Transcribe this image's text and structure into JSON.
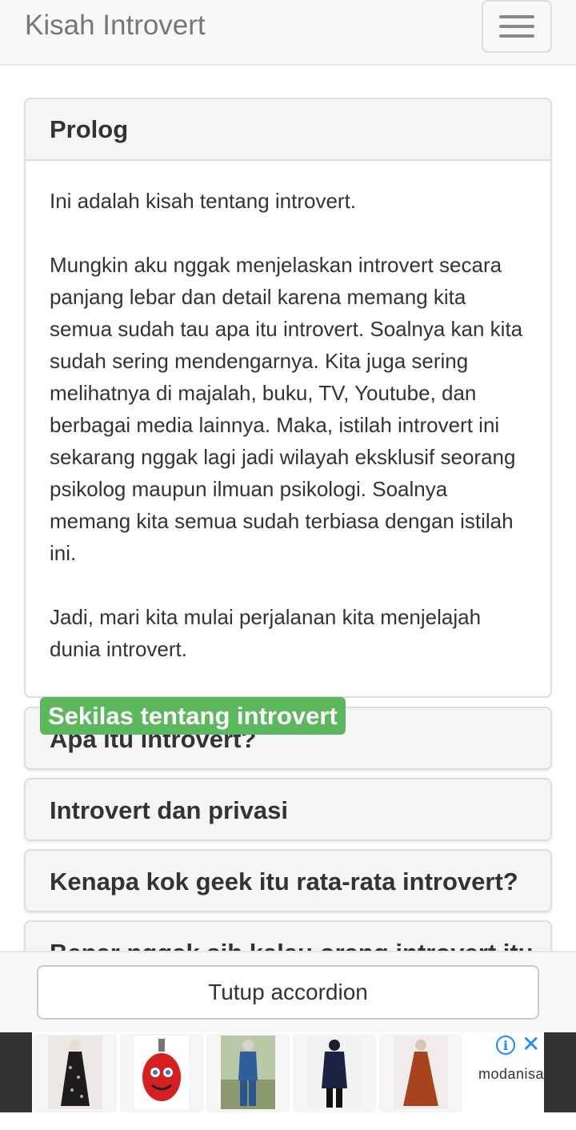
{
  "navbar": {
    "brand": "Kisah Introvert"
  },
  "accordion": {
    "open_panel": {
      "title": "Prolog",
      "paragraphs": [
        "Ini adalah kisah tentang introvert.",
        "Mungkin aku nggak menjelaskan introvert secara panjang lebar dan detail karena memang kita semua sudah tau apa itu introvert. Soalnya kan kita sudah sering mendengarnya. Kita juga sering melihatnya di majalah, buku, TV, Youtube, dan berbagai media lainnya. Maka, istilah introvert ini sekarang nggak lagi jadi wilayah eksklusif seorang psikolog maupun ilmuan psikologi. Soalnya memang kita semua sudah terbiasa dengan istilah ini.",
        "Jadi, mari kita mulai perjalanan kita menjelajah dunia introvert."
      ]
    },
    "section_badge": "Sekilas tentang introvert",
    "collapsed_panels": [
      "Apa itu introvert?",
      "Introvert dan privasi",
      "Kenapa kok geek itu rata-rata introvert?",
      "Benar nggak sih kalau orang introvert itu"
    ]
  },
  "footer": {
    "close_accordion_label": "Tutup accordion"
  },
  "ad": {
    "brand": "modanisa",
    "info_icon": "i",
    "close_icon": "✕",
    "products": [
      "floral-dress",
      "kids-backpack",
      "denim-set",
      "navy-tunic",
      "rust-dress"
    ]
  },
  "colors": {
    "badge": "#5cb85c",
    "ad_accent": "#1a8cff"
  }
}
